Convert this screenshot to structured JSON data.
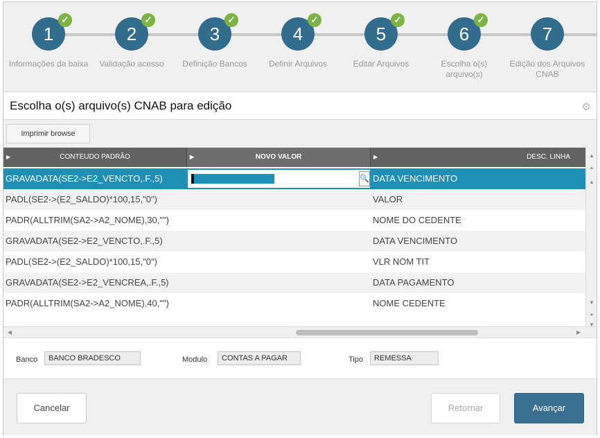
{
  "steps": [
    {
      "number": "1",
      "label": "Informações da baixa",
      "done": true
    },
    {
      "number": "2",
      "label": "Validação acesso",
      "done": true
    },
    {
      "number": "3",
      "label": "Definição Bancos",
      "done": true
    },
    {
      "number": "4",
      "label": "Definir Arquivos",
      "done": true
    },
    {
      "number": "5",
      "label": "Editar Arquivos",
      "done": true
    },
    {
      "number": "6",
      "label": "Escolha o(s) arquivo(s)",
      "done": true
    },
    {
      "number": "7",
      "label": "Edição dos Arquivos CNAB",
      "done": false
    }
  ],
  "header": {
    "title": "Escolha o(s) arquivo(s) CNAB para edição",
    "settings_icon": "gear-icon"
  },
  "toolbar": {
    "print_label": "Imprimir browse"
  },
  "grid": {
    "columns": [
      "CONTEUDO PADRÃO",
      "NOVO VALOR",
      "DESC. LINHA"
    ],
    "selected_row": 0,
    "rows": [
      {
        "conteudo": "GRAVADATA(SE2->E2_VENCTO,.F.,5)",
        "novo": "",
        "desc": "DATA VENCIMENTO"
      },
      {
        "conteudo": "PADL(SE2->(E2_SALDO)*100,15,\"0\")",
        "novo": "",
        "desc": "VALOR"
      },
      {
        "conteudo": "PADR(ALLTRIM(SA2->A2_NOME),30,\"\")",
        "novo": "",
        "desc": "NOME DO CEDENTE"
      },
      {
        "conteudo": "GRAVADATA(SE2->E2_VENCTO,.F.,5)",
        "novo": "",
        "desc": "DATA VENCIMENTO"
      },
      {
        "conteudo": "PADL(SE2->(E2_SALDO)*100,15,\"0\")",
        "novo": "",
        "desc": "VLR NOM TIT"
      },
      {
        "conteudo": "GRAVADATA(SE2->E2_VENCREA,.F.,5)",
        "novo": "",
        "desc": "DATA PAGAMENTO"
      },
      {
        "conteudo": "PADR(ALLTRIM(SA2->A2_NOME),40,\"\")",
        "novo": "",
        "desc": "NOME CEDENTE"
      }
    ]
  },
  "fields": {
    "banco_label": "Banco",
    "banco_value": "BANCO BRADESCO",
    "modulo_label": "Modulo",
    "modulo_value": "CONTAS A PAGAR",
    "tipo_label": "Tipo",
    "tipo_value": "REMESSA"
  },
  "actions": {
    "cancel_label": "Cancelar",
    "back_label": "Retornar",
    "next_label": "Avançar"
  },
  "colors": {
    "step_circle": "#336d8e",
    "step_done_check": "#7cb342",
    "selected_row": "#1e8fb5",
    "primary_button": "#3b6f8f"
  }
}
